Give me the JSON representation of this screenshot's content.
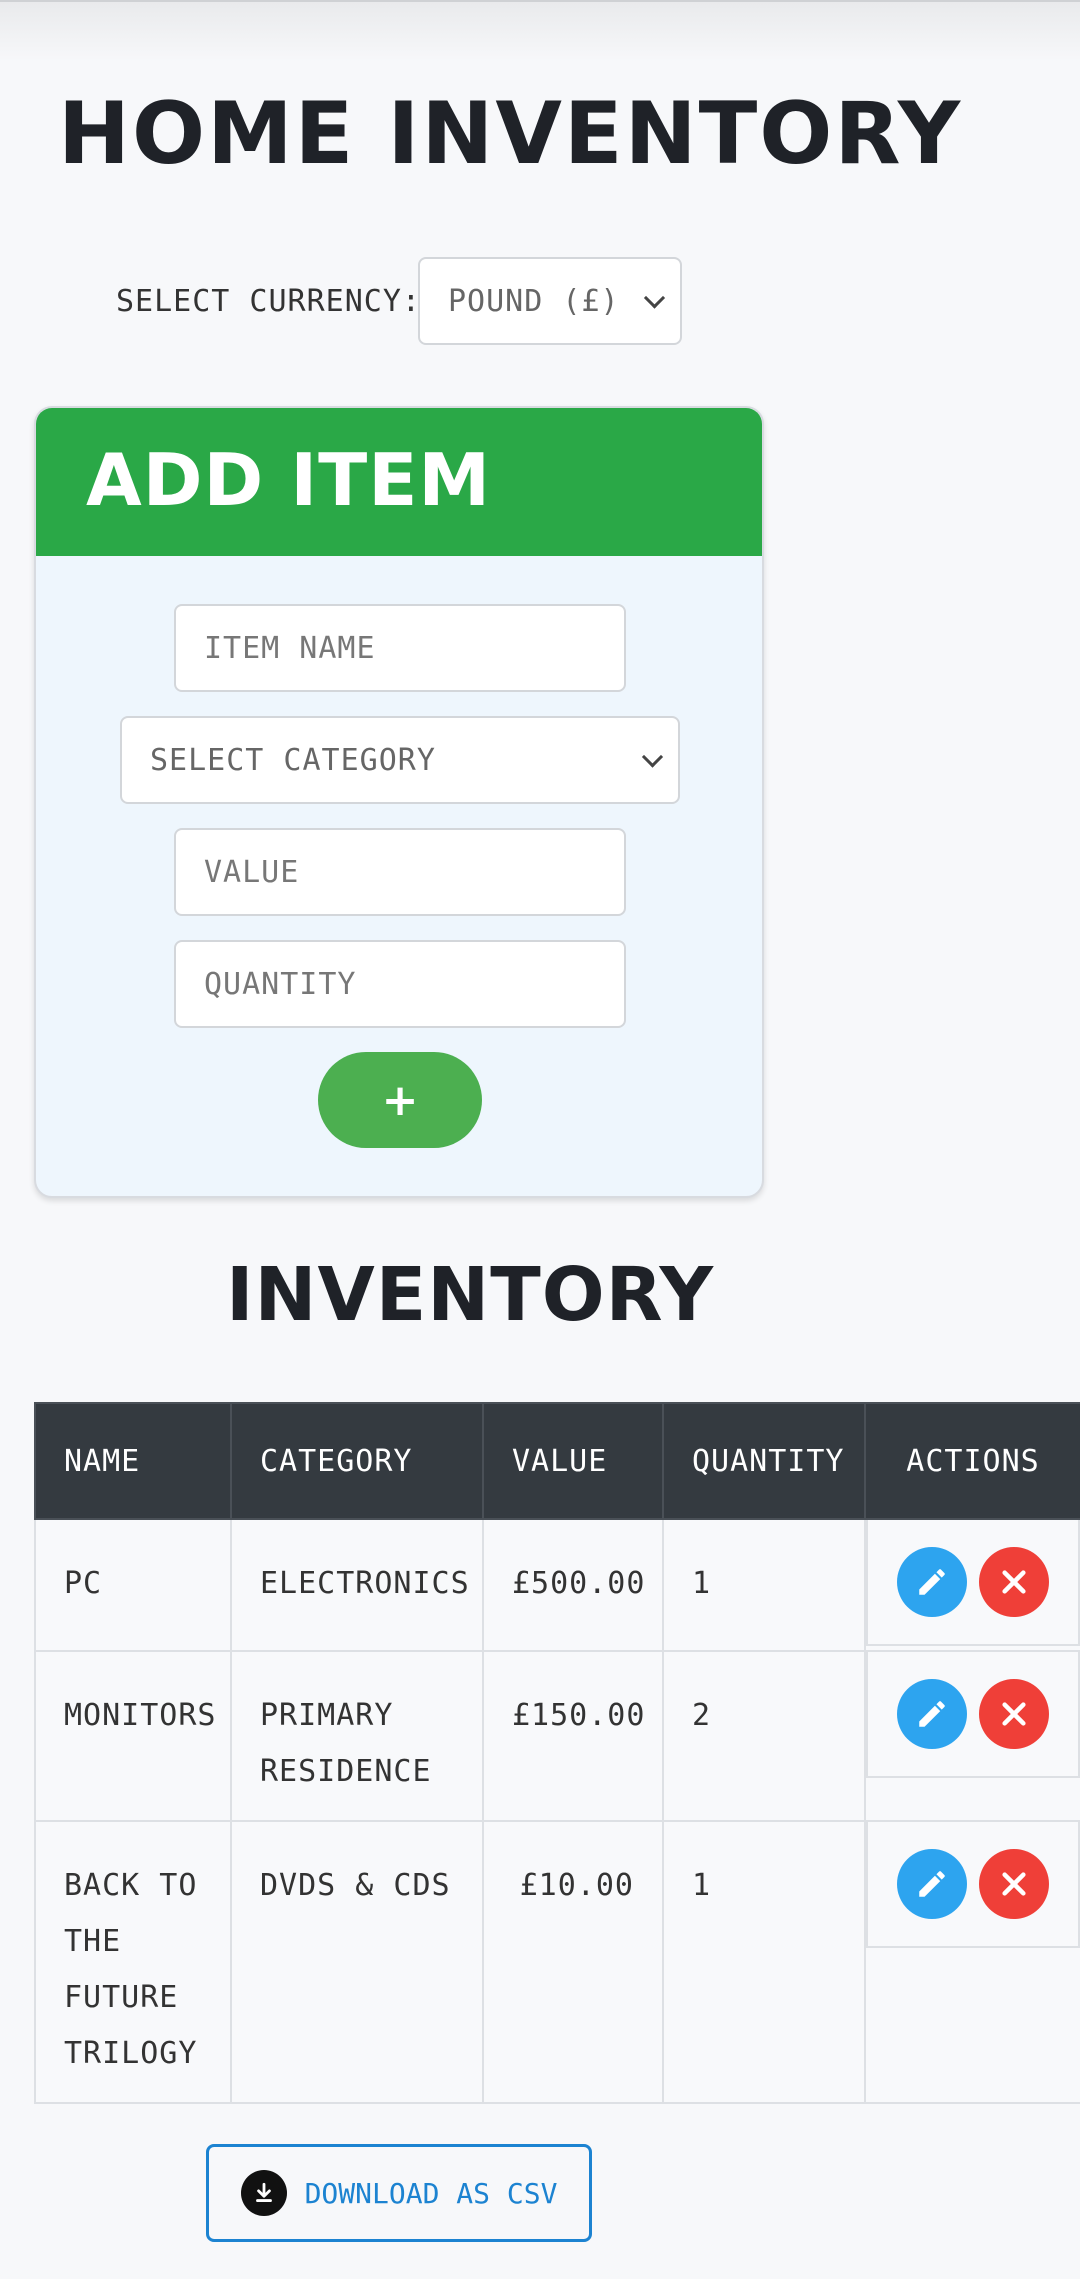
{
  "app": {
    "title": "Home Inventory"
  },
  "currency": {
    "label": "Select currency:",
    "selected": "Pound (£)"
  },
  "add_item": {
    "title": "Add Item",
    "name_placeholder": "Item Name",
    "category_selected": "Select Category",
    "value_placeholder": "Value",
    "quantity_placeholder": "Quantity",
    "add_label": "+"
  },
  "inventory": {
    "title": "Inventory",
    "columns": [
      "Name",
      "Category",
      "Value",
      "Quantity",
      "Actions"
    ],
    "rows": [
      {
        "name": "PC",
        "category": "Electronics",
        "value": "£500.00",
        "quantity": "1"
      },
      {
        "name": "Monitors",
        "category": "Primary Residence",
        "value": "£150.00",
        "quantity": "2"
      },
      {
        "name": "Back to the Future Trilogy",
        "category": "DVDs & CDs",
        "value": "£10.00",
        "quantity": "1"
      }
    ]
  },
  "download": {
    "label": "Download as CSV"
  },
  "icons": {
    "edit": "pencil-icon",
    "delete": "close-icon",
    "download": "download-icon"
  },
  "colors": {
    "header_green": "#2aa847",
    "add_button": "#4caf50",
    "edit": "#2da4ef",
    "delete": "#ef3f38",
    "table_head": "#343a40",
    "link_blue": "#1c83d1"
  }
}
